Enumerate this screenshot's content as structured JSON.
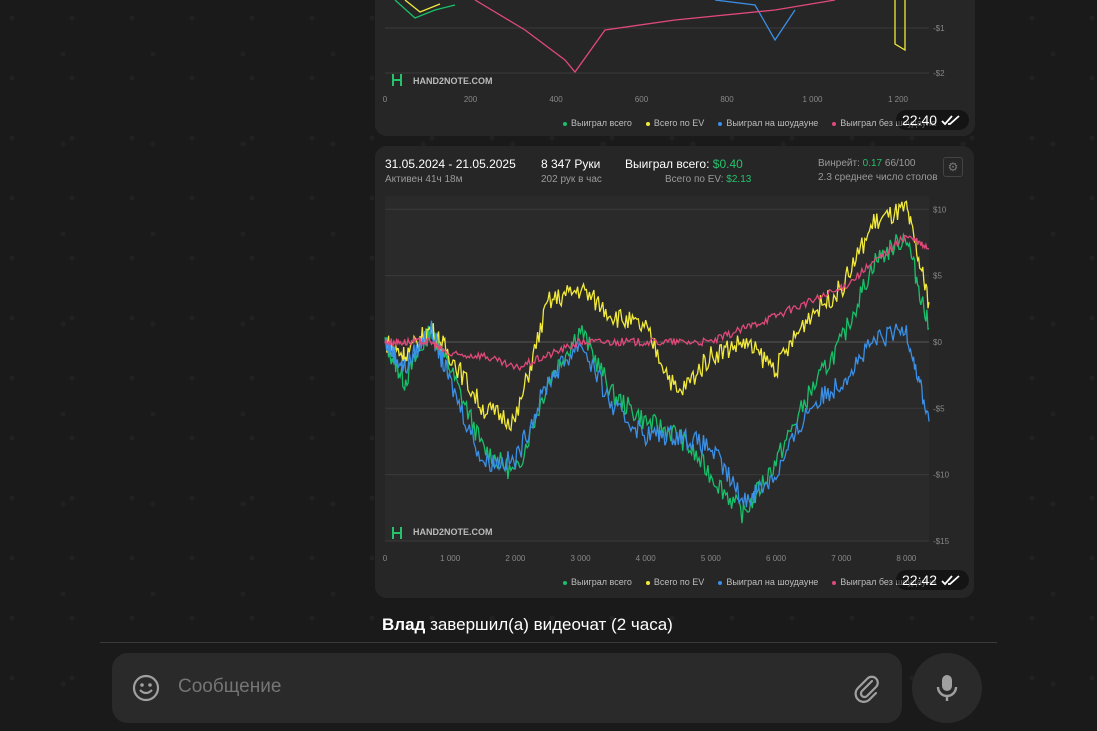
{
  "messages": [
    {
      "time": "22:40",
      "chart": {
        "watermark": "HAND2NOTE.COM",
        "x_ticks": [
          "0",
          "200",
          "400",
          "600",
          "800",
          "1 000",
          "1 200"
        ],
        "y_ticks": [
          "-$1",
          "-$2"
        ],
        "legend": [
          "Выиграл всего",
          "Всего по EV",
          "Выиграл на шоудауне",
          "Выиграл без шоудауна"
        ]
      }
    },
    {
      "time": "22:42",
      "header": {
        "date_range": "31.05.2024 - 21.05.2025",
        "active": "Активен 41ч 18м",
        "hands": "8 347 Руки",
        "hands_rate": "202 рук в час",
        "won_label": "Выиграл всего:",
        "won_value": "$0.40",
        "ev_label": "Всего по EV:",
        "ev_value": "$2.13",
        "winrate_label": "Винрейт:",
        "winrate_value": "0.17",
        "winrate_unit": "66/100",
        "tables": "2.3 среднее число столов"
      },
      "chart": {
        "watermark": "HAND2NOTE.COM",
        "x_ticks": [
          "0",
          "1 000",
          "2 000",
          "3 000",
          "4 000",
          "5 000",
          "6 000",
          "7 000",
          "8 000"
        ],
        "y_ticks": [
          "$10",
          "$5",
          "$0",
          "-$5",
          "-$10",
          "-$15"
        ],
        "legend": [
          "Выиграл всего",
          "Всего по EV",
          "Выиграл на шоудауне",
          "Выиграл без шоудауна"
        ]
      }
    }
  ],
  "chart_data": {
    "type": "line",
    "xlim": [
      0,
      8347
    ],
    "ylim": [
      -15,
      11
    ],
    "series": [
      {
        "name": "Выиграл всего",
        "color": "#18c06a",
        "x": [
          0,
          300,
          700,
          1000,
          1500,
          2000,
          2500,
          3000,
          3500,
          4000,
          4500,
          5000,
          5500,
          6000,
          6500,
          7000,
          7500,
          8000,
          8347
        ],
        "values": [
          0,
          -3,
          1,
          -2,
          -8,
          -10,
          -3,
          1,
          -4,
          -6,
          -7,
          -10,
          -13,
          -9,
          -4,
          0,
          6,
          8,
          1
        ]
      },
      {
        "name": "Всего по EV",
        "color": "#f2ea3a",
        "x": [
          0,
          300,
          700,
          1000,
          1500,
          2000,
          2500,
          3000,
          3500,
          4000,
          4500,
          5000,
          5500,
          6000,
          6500,
          7000,
          7500,
          8000,
          8347
        ],
        "values": [
          0,
          -1,
          1,
          -1,
          -5,
          -6,
          3,
          4,
          2,
          1,
          -4,
          -1,
          0,
          -2,
          2,
          4,
          9,
          10,
          3
        ]
      },
      {
        "name": "Выиграл на шоудауне",
        "color": "#3a8fe6",
        "x": [
          0,
          300,
          700,
          1000,
          1500,
          2000,
          2500,
          3000,
          3500,
          4000,
          4500,
          5000,
          5500,
          6000,
          6500,
          7000,
          7500,
          8000,
          8347
        ],
        "values": [
          0,
          -2,
          1,
          -3,
          -9,
          -9,
          -3,
          0,
          -5,
          -7,
          -7,
          -8,
          -12,
          -10,
          -5,
          -3,
          0,
          1,
          -6
        ]
      },
      {
        "name": "Выиграл без шоудауна",
        "color": "#e0497a",
        "x": [
          0,
          300,
          700,
          1000,
          1500,
          2000,
          2500,
          3000,
          3500,
          4000,
          4500,
          5000,
          5500,
          6000,
          6500,
          7000,
          7500,
          8000,
          8347
        ],
        "values": [
          0,
          0,
          0,
          -1,
          -1,
          -2,
          -1,
          0,
          0,
          0,
          0,
          0,
          1,
          2,
          3,
          4,
          6,
          8,
          7
        ]
      }
    ]
  },
  "system_message": {
    "author": "Влад",
    "text": "завершил(а) видеочат (2 часа)"
  },
  "composer": {
    "placeholder": "Сообщение"
  },
  "icons": {
    "emoji": "emoji-icon",
    "attach": "paperclip-icon",
    "mic": "microphone-icon",
    "read": "double-check-icon",
    "settings": "gear-icon"
  },
  "colors": {
    "accent_green": "#25c26b",
    "background": "#181818",
    "bubble": "#2b2b2b"
  }
}
